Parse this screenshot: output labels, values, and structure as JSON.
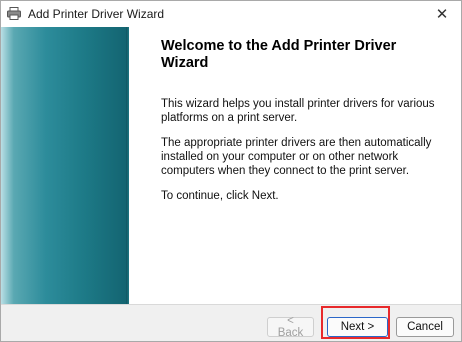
{
  "window": {
    "title": "Add Printer Driver Wizard",
    "close_symbol": "✕",
    "icon": "printer-icon"
  },
  "content": {
    "heading": "Welcome to the Add Printer Driver Wizard",
    "paragraphs": [
      "This wizard helps you install printer drivers for various platforms on a print server.",
      "The appropriate printer drivers are then automatically installed on your computer or on other network computers when they connect to the print server.",
      "To continue, click Next."
    ]
  },
  "buttons": {
    "back": "< Back",
    "next": "Next >",
    "cancel": "Cancel"
  },
  "colors": {
    "banner_dark": "#136370",
    "banner_light": "#b9dfe5",
    "highlight": "#e8292b"
  }
}
